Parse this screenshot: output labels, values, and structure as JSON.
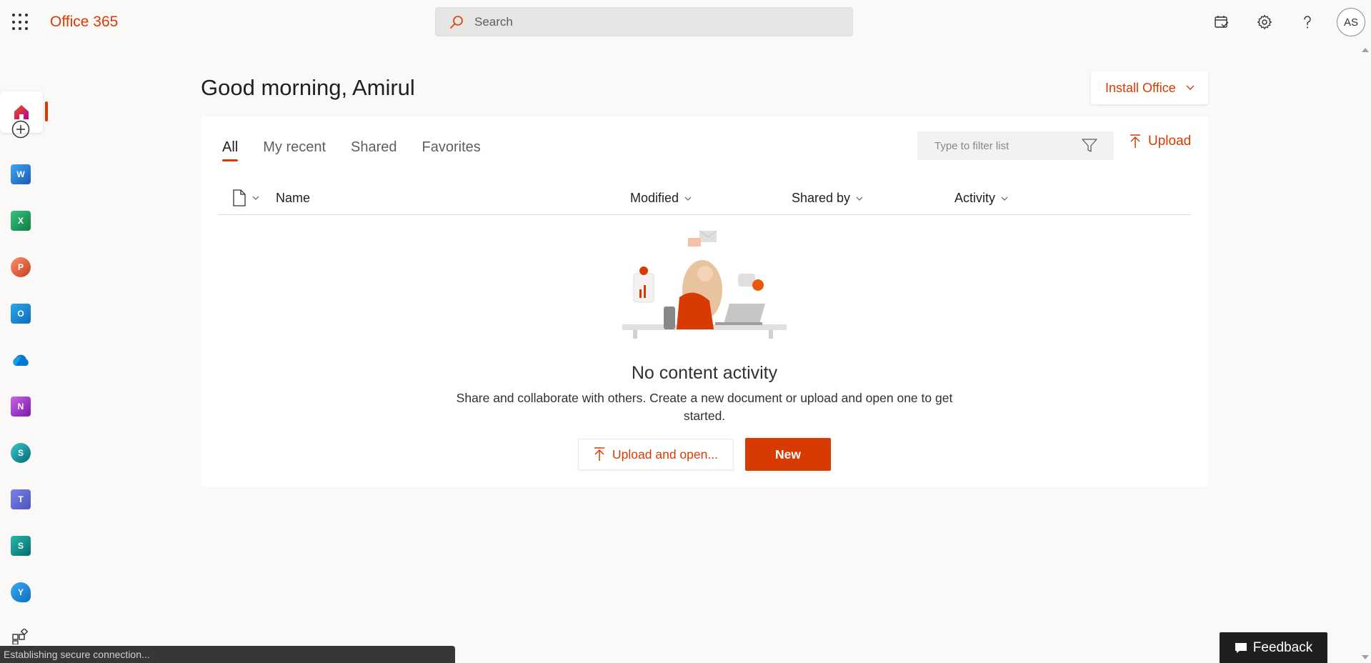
{
  "topbar": {
    "brand": "Office 365",
    "search_placeholder": "Search",
    "avatar_initials": "AS"
  },
  "greeting": "Good morning, Amirul",
  "install_office": "Install Office",
  "tabs": [
    {
      "label": "All",
      "active": true
    },
    {
      "label": "My recent",
      "active": false
    },
    {
      "label": "Shared",
      "active": false
    },
    {
      "label": "Favorites",
      "active": false
    }
  ],
  "filter_placeholder": "Type to filter list",
  "upload_label": "Upload",
  "columns": {
    "name": "Name",
    "modified": "Modified",
    "shared_by": "Shared by",
    "activity": "Activity"
  },
  "empty_state": {
    "title": "No content activity",
    "description": "Share and collaborate with others. Create a new document or upload and open one to get started.",
    "upload_open": "Upload and open...",
    "new": "New"
  },
  "rail": {
    "apps": [
      {
        "name": "word",
        "letter": "W",
        "color": "#185abd"
      },
      {
        "name": "excel",
        "letter": "X",
        "color": "#107c41"
      },
      {
        "name": "powerpoint",
        "letter": "P",
        "color": "#c43e1c"
      },
      {
        "name": "outlook",
        "letter": "O",
        "color": "#0f6cbd"
      },
      {
        "name": "onedrive",
        "letter": "",
        "color": "#0078d4"
      },
      {
        "name": "onenote",
        "letter": "N",
        "color": "#7719aa"
      },
      {
        "name": "sharepoint",
        "letter": "S",
        "color": "#036c70"
      },
      {
        "name": "teams",
        "letter": "T",
        "color": "#5059c9"
      },
      {
        "name": "sway",
        "letter": "S",
        "color": "#008272"
      },
      {
        "name": "yammer",
        "letter": "Y",
        "color": "#106ebe"
      }
    ]
  },
  "feedback": "Feedback",
  "status_text": "Establishing secure connection...",
  "colors": {
    "accent": "#d83b01",
    "background": "#faf9f8"
  }
}
